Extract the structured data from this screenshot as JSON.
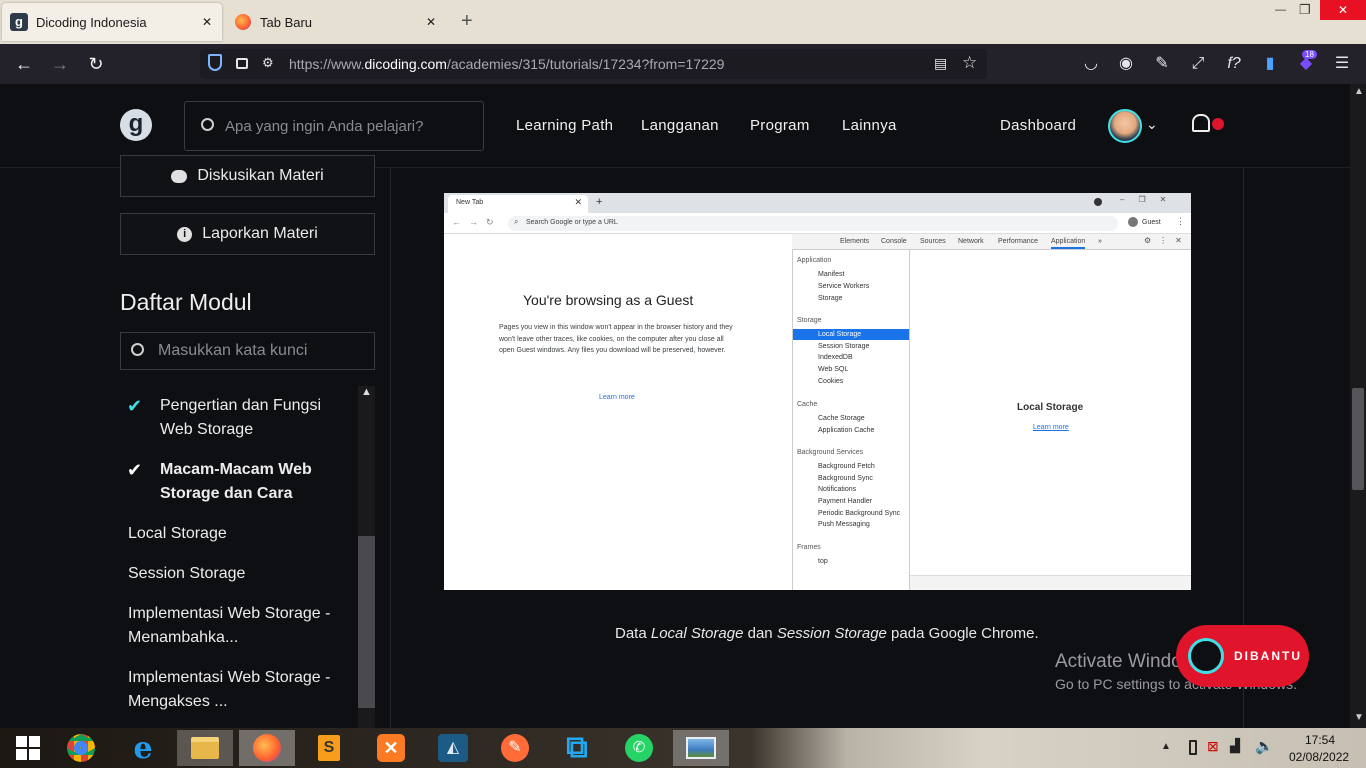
{
  "tabs": [
    {
      "title": "Dicoding Indonesia",
      "icon": "dicoding-logo-icon",
      "close": "✕"
    },
    {
      "title": "Tab Baru",
      "icon": "firefox-icon",
      "close": "✕"
    }
  ],
  "new_tab": "+",
  "window_controls": {
    "minimize": "—",
    "restore": "❐",
    "close": "✕"
  },
  "url": {
    "prefix": "https://www.",
    "domain": "dicoding.com",
    "path": "/academies/315/tutorials/17234?from=17229"
  },
  "toolbar_badge": "18",
  "site": {
    "logo": "g",
    "search_placeholder": "Apa yang ingin Anda pelajari?",
    "nav": [
      "Learning Path",
      "Langganan",
      "Program",
      "Lainnya"
    ],
    "dashboard": "Dashboard",
    "sidebar": {
      "discuss_label": "Diskusikan Materi",
      "report_label": "Laporkan Materi",
      "module_title": "Daftar Modul",
      "module_search_placeholder": "Masukkan kata kunci",
      "items": [
        {
          "label": "Pengertian dan Fungsi Web Storage",
          "done": true,
          "bold": false
        },
        {
          "label": "Macam-Macam Web Storage dan Cara",
          "done": true,
          "bold": true
        },
        {
          "label": "Local Storage",
          "done": false,
          "bold": false
        },
        {
          "label": "Session Storage",
          "done": false,
          "bold": false
        },
        {
          "label": "Implementasi Web Storage - Menambahka...",
          "done": false,
          "bold": false
        },
        {
          "label": "Implementasi Web Storage - Mengakses ...",
          "done": false,
          "bold": false
        }
      ]
    },
    "caption": {
      "part1": "Data ",
      "italic1": "Local Storage",
      "part2": " dan ",
      "italic2": "Session Storage",
      "part3": " pada Google Chrome."
    },
    "dibantu": "DIBANTU"
  },
  "inner_screenshot": {
    "tab": "New Tab",
    "omnibox_placeholder": "Search Google or type a URL",
    "guest": "Guest",
    "guest_title": "You're browsing as a Guest",
    "guest_body": "Pages you view in this window won't appear in the browser history and they won't leave other traces, like cookies, on the computer after you close all open Guest windows. Any files you download will be preserved, however.",
    "learn_more": "Learn more",
    "devtools_tabs": [
      "Elements",
      "Console",
      "Sources",
      "Network",
      "Performance",
      "Application"
    ],
    "devtools_more": "»",
    "sections": {
      "application": {
        "head": "Application",
        "items": [
          "Manifest",
          "Service Workers",
          "Storage"
        ]
      },
      "storage": {
        "head": "Storage",
        "items": [
          "Local Storage",
          "Session Storage",
          "IndexedDB",
          "Web SQL",
          "Cookies"
        ]
      },
      "cache": {
        "head": "Cache",
        "items": [
          "Cache Storage",
          "Application Cache"
        ]
      },
      "background": {
        "head": "Background Services",
        "items": [
          "Background Fetch",
          "Background Sync",
          "Notifications",
          "Payment Handler",
          "Periodic Background Sync",
          "Push Messaging"
        ]
      },
      "frames": {
        "head": "Frames",
        "items": [
          "top"
        ]
      }
    },
    "panel_title": "Local Storage",
    "panel_link": "Learn more"
  },
  "watermark": {
    "line1": "Activate Windows",
    "line2": "Go to PC settings to activate Windows."
  },
  "taskbar": {
    "time": "17:54",
    "date": "02/08/2022"
  },
  "colors": {
    "accent": "#3ee0e6",
    "highlight": "#1a73e8",
    "dibantu": "#e0142a"
  }
}
